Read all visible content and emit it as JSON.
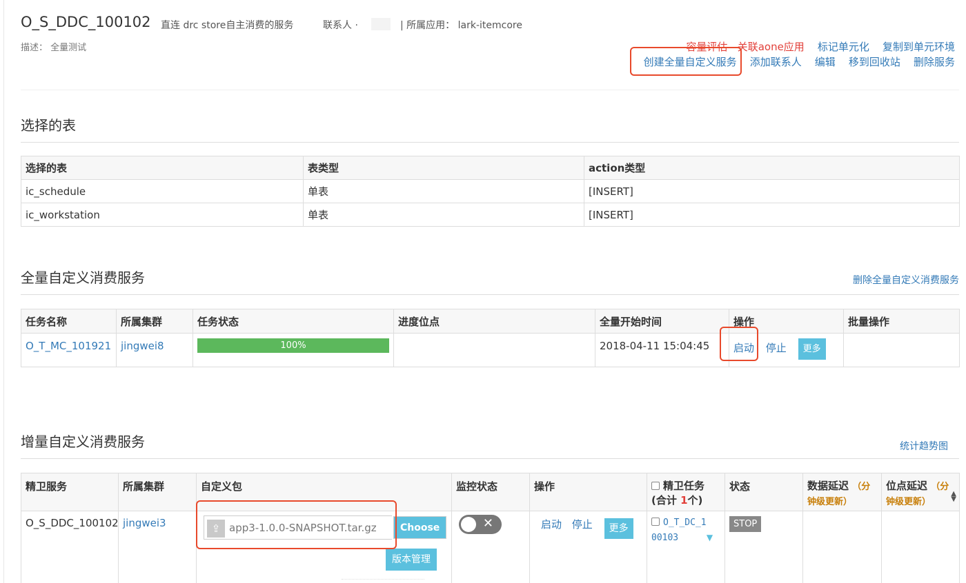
{
  "header": {
    "title": "O_S_DDC_100102",
    "subtitle": "直连 drc store自主消费的服务",
    "contact_label": "联系人 ·",
    "app_label": "|  所属应用：",
    "app_name": "lark-itemcore",
    "description": "描述： 全量测试"
  },
  "actions": {
    "capacity_eval": "容量评估",
    "link_aone": "关联aone应用",
    "mark_unit": "标记单元化",
    "copy_unit_env": "复制到单元环境",
    "create_full_service": "创建全量自定义服务",
    "add_contact": "添加联系人",
    "edit": "编辑",
    "move_to_recycle": "移到回收站",
    "delete_service": "删除服务"
  },
  "selected_tables": {
    "heading": "选择的表",
    "columns": [
      "选择的表",
      "表类型",
      "action类型"
    ],
    "rows": [
      [
        "ic_schedule",
        "单表",
        "[INSERT]"
      ],
      [
        "ic_workstation",
        "单表",
        "[INSERT]"
      ]
    ]
  },
  "full_service": {
    "heading": "全量自定义消费服务",
    "delete_link": "删除全量自定义消费服务",
    "columns": [
      "任务名称",
      "所属集群",
      "任务状态",
      "进度位点",
      "全量开始时间",
      "操作",
      "批量操作"
    ],
    "row": {
      "task_name": "O_T_MC_101921",
      "cluster": "jingwei8",
      "progress": 100,
      "progress_label": "100%",
      "position": "",
      "start_time": "2018-04-11 15:04:45",
      "start": "启动",
      "stop": "停止",
      "more": "更多"
    }
  },
  "incr_service": {
    "heading": "增量自定义消费服务",
    "trend_link": "统计趋势图",
    "columns": {
      "service": "精卫服务",
      "cluster": "所属集群",
      "package": "自定义包",
      "monitor": "监控状态",
      "operation": "操作",
      "task": "精卫任务",
      "task_total_prefix": "(合计 ",
      "task_total_count": "1",
      "task_total_suffix": "个)",
      "status": "状态",
      "data_delay": "数据延迟",
      "data_delay_note": "（分钟级更新）",
      "pos_delay": "位点延迟",
      "pos_delay_note": "（分钟级更新）"
    },
    "row": {
      "service": "O_S_DDC_100102",
      "cluster": "jingwei3",
      "package_file": "app3-1.0.0-SNAPSHOT.tar.gz",
      "choose": "Choose",
      "version_mgmt": "版本管理",
      "start": "启动",
      "stop": "停止",
      "more": "更多",
      "task_line1": "O_T_DC_1",
      "task_line2": "00103",
      "status": "STOP"
    }
  },
  "colors": {
    "link": "#337ab7",
    "warning_link": "#e2403a",
    "progress": "#5cb85c",
    "button": "#5bc0de",
    "highlight_box": "#e8492b"
  }
}
